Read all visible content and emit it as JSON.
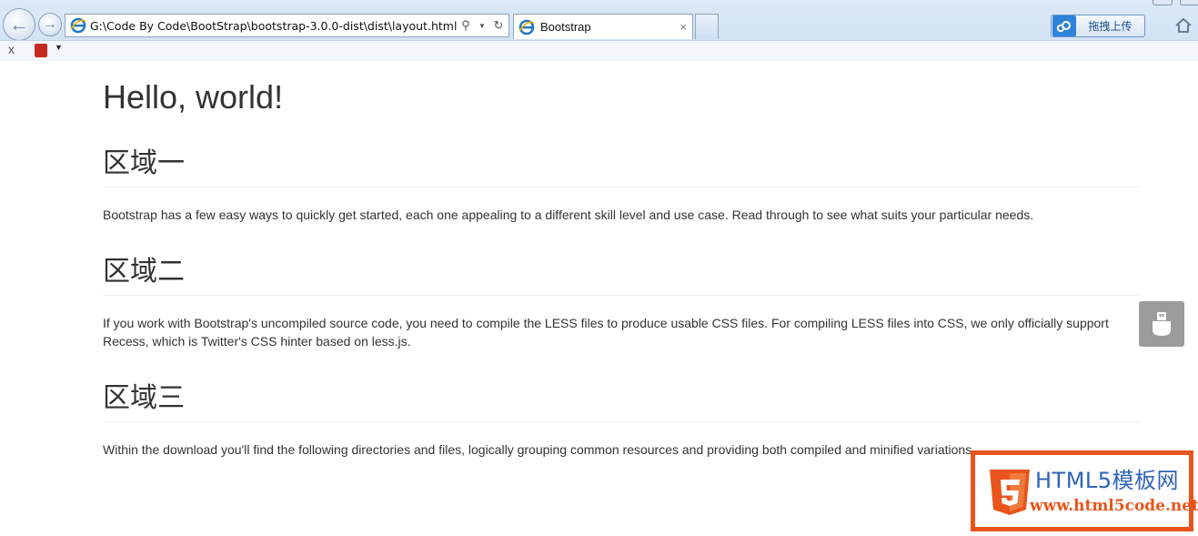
{
  "browser": {
    "address_url": "G:\\Code By Code\\BootStrap\\bootstrap-3.0.0-dist\\dist\\layout.html",
    "tab_title": "Bootstrap",
    "tab_close": "×",
    "upload_button_label": "拖拽上传",
    "command_close": "x"
  },
  "page": {
    "heading": "Hello, world!",
    "sections": [
      {
        "title": "区域一",
        "text": "Bootstrap has a few easy ways to quickly get started, each one appealing to a different skill level and use case. Read through to see what suits your particular needs."
      },
      {
        "title": "区域二",
        "text": "If you work with Bootstrap's uncompiled source code, you need to compile the LESS files to produce usable CSS files. For compiling LESS files into CSS, we only officially support Recess, which is Twitter's CSS hinter based on less.js."
      },
      {
        "title": "区域三",
        "text": "Within the download you'll find the following directories and files, logically grouping common resources and providing both compiled and minified variations."
      }
    ]
  },
  "watermark": {
    "title": "HTML5模板网",
    "url": "www.html5code.net",
    "brand_color": "#e9541c"
  },
  "icons": [
    "back-arrow-icon",
    "forward-arrow-icon",
    "ie-icon",
    "search-icon",
    "refresh-icon",
    "cloud-upload-icon",
    "home-icon",
    "pdf-icon",
    "usb-drive-icon",
    "html5-shield-icon"
  ]
}
